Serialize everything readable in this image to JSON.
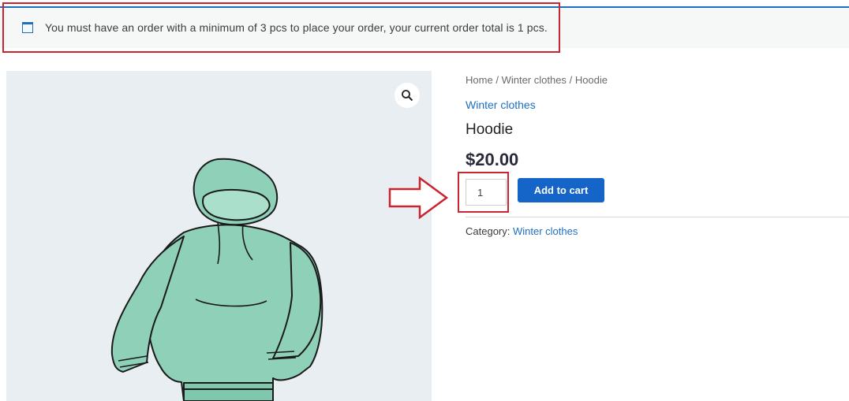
{
  "notice": {
    "icon": "window-icon",
    "text": "You must have an order with a minimum of 3 pcs to place your order, your current order total is 1 pcs."
  },
  "breadcrumb": {
    "items": [
      "Home",
      "Winter clothes",
      "Hoodie"
    ],
    "separator": "/"
  },
  "product": {
    "category_link": "Winter clothes",
    "title": "Hoodie",
    "price": "$20.00",
    "quantity": "1",
    "add_to_cart_label": "Add to cart",
    "meta_label": "Category:",
    "meta_value": "Winter clothes"
  },
  "colors": {
    "accent": "#1565c8",
    "annotation": "#c9252f",
    "hoodie": "#8fd0b8"
  }
}
